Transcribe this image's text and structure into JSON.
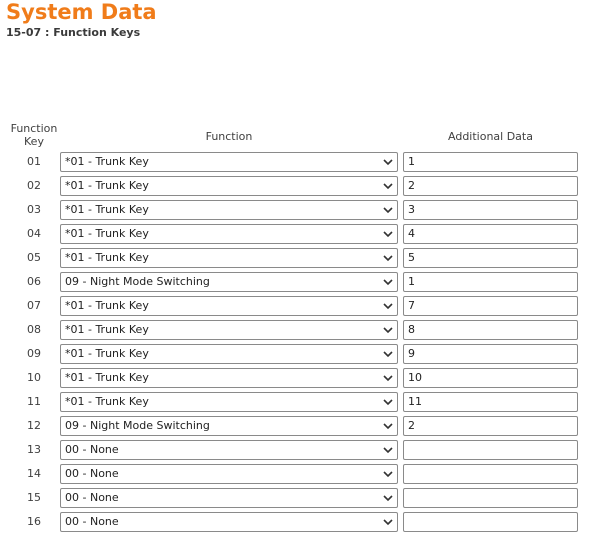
{
  "header": {
    "title": "System Data",
    "subtitle": "15-07 : Function Keys"
  },
  "columns": {
    "function_key": "Function Key",
    "function": "Function",
    "additional_data": "Additional Data"
  },
  "rows": [
    {
      "key": "01",
      "function": "*01 - Trunk Key",
      "additional": "1"
    },
    {
      "key": "02",
      "function": "*01 - Trunk Key",
      "additional": "2"
    },
    {
      "key": "03",
      "function": "*01 - Trunk Key",
      "additional": "3"
    },
    {
      "key": "04",
      "function": "*01 - Trunk Key",
      "additional": "4"
    },
    {
      "key": "05",
      "function": "*01 - Trunk Key",
      "additional": "5"
    },
    {
      "key": "06",
      "function": "09 - Night Mode Switching",
      "additional": "1"
    },
    {
      "key": "07",
      "function": "*01 - Trunk Key",
      "additional": "7"
    },
    {
      "key": "08",
      "function": "*01 - Trunk Key",
      "additional": "8"
    },
    {
      "key": "09",
      "function": "*01 - Trunk Key",
      "additional": "9"
    },
    {
      "key": "10",
      "function": "*01 - Trunk Key",
      "additional": "10"
    },
    {
      "key": "11",
      "function": "*01 - Trunk Key",
      "additional": "11"
    },
    {
      "key": "12",
      "function": "09 - Night Mode Switching",
      "additional": "2"
    },
    {
      "key": "13",
      "function": "00 - None",
      "additional": ""
    },
    {
      "key": "14",
      "function": "00 - None",
      "additional": ""
    },
    {
      "key": "15",
      "function": "00 - None",
      "additional": ""
    },
    {
      "key": "16",
      "function": "00 - None",
      "additional": ""
    }
  ],
  "colors": {
    "title": "#f07c1a"
  },
  "icons": {
    "dropdown": "chevron-down-icon"
  }
}
